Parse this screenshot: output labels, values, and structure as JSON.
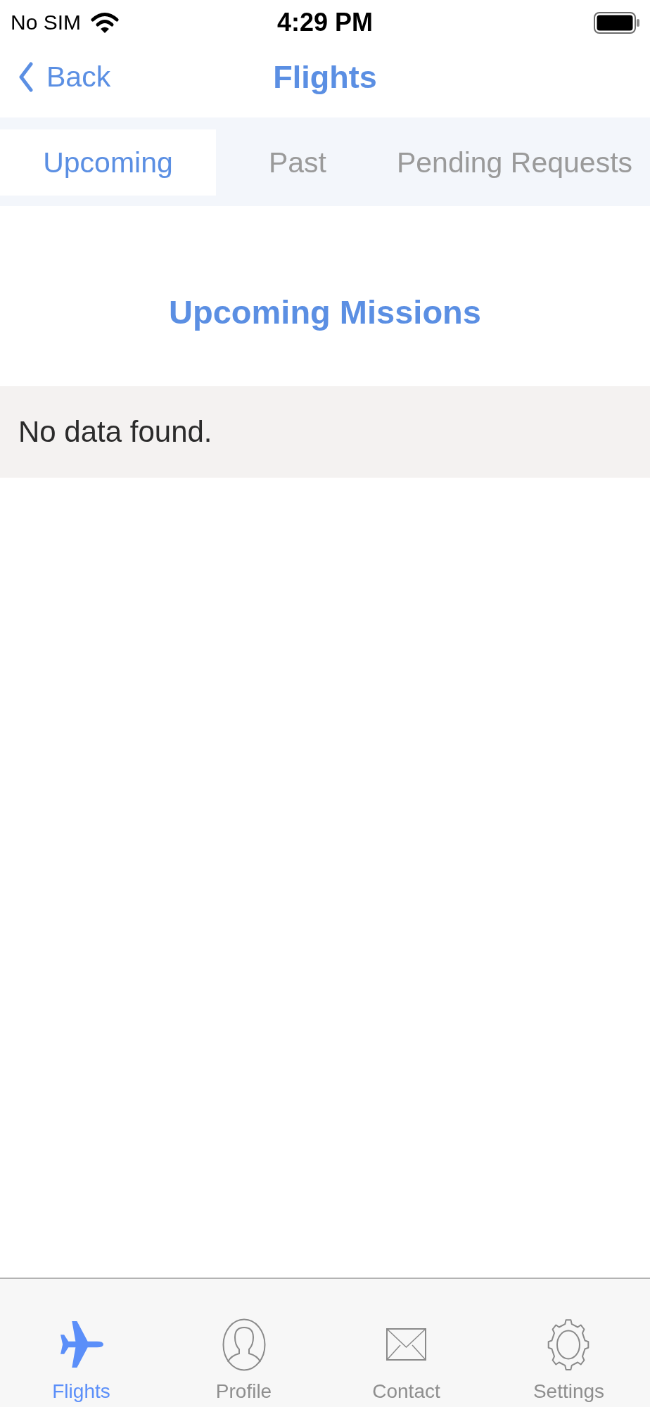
{
  "status_bar": {
    "carrier": "No SIM",
    "time": "4:29 PM"
  },
  "nav_bar": {
    "back_label": "Back",
    "title": "Flights"
  },
  "tabs": [
    {
      "label": "Upcoming",
      "selected": true
    },
    {
      "label": "Past",
      "selected": false
    },
    {
      "label": "Pending Requests",
      "selected": false
    }
  ],
  "section_title": "Upcoming Missions",
  "rows": [
    {
      "text": "No data found."
    }
  ],
  "tab_bar": {
    "items": [
      {
        "label": "Flights",
        "kind": "plane",
        "selected": true
      },
      {
        "label": "Profile",
        "kind": "person",
        "selected": false
      },
      {
        "label": "Contact",
        "kind": "envelope",
        "selected": false
      },
      {
        "label": "Settings",
        "kind": "gear",
        "selected": false
      }
    ]
  }
}
